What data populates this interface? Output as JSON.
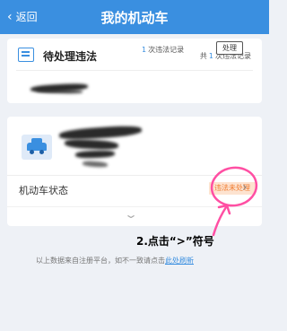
{
  "header": {
    "back_label": "返回",
    "title": "我的机动车",
    "background": "#3a8fe0"
  },
  "pending": {
    "title": "待处理违法",
    "total_prefix": "共",
    "total_count": "1",
    "total_suffix": "次违法记录",
    "row_count": "1",
    "row_suffix": "次违法记录",
    "process_label": "处理"
  },
  "vehicle": {
    "status_label": "机动车状态",
    "status_value": "违法未处理",
    "status_color": "#f07b2e"
  },
  "annotation": {
    "text": "2.点击“>”符号",
    "color": "#ff4fa3"
  },
  "footer": {
    "note": "以上数据来自注册平台，如不一致请点击",
    "link": "此处刷新"
  }
}
